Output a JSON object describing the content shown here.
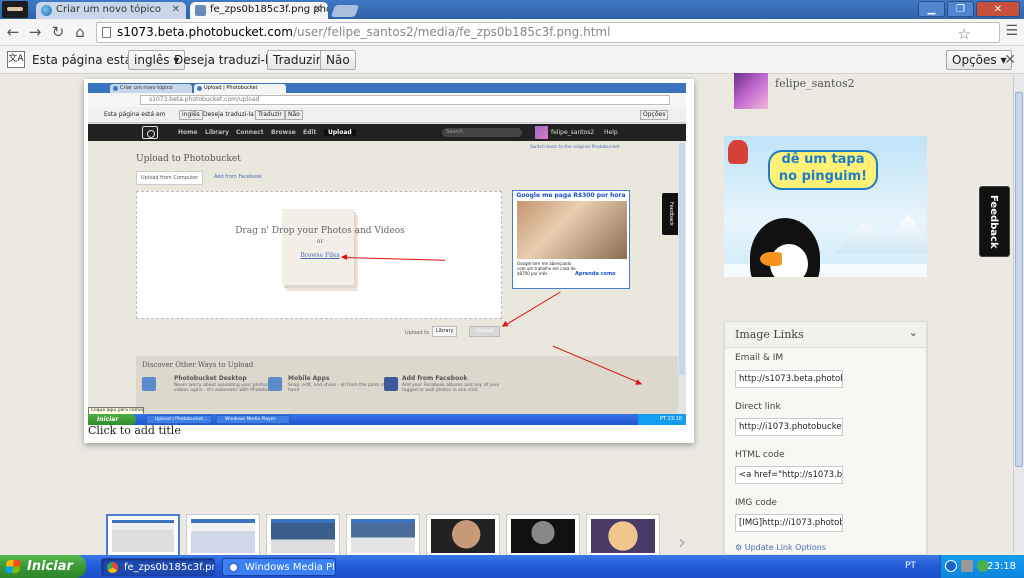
{
  "browser": {
    "tabs": [
      {
        "label": "Criar um novo tópico"
      },
      {
        "label": "fe_zps0b185c3f.png photo b"
      }
    ],
    "url_host": "s1073.beta.photobucket.com",
    "url_path": "/user/felipe_santos2/media/fe_zps0b185c3f.png.html"
  },
  "translate_bar": {
    "prefix": "Esta página está em",
    "language": "inglês",
    "question": "Deseja traduzi-la?",
    "translate": "Traduzir",
    "no": "Não",
    "options": "Opções"
  },
  "viewer": {
    "caption": "Click to add title",
    "inner": {
      "tabs": [
        "Criar um novo tópico",
        "Upload | Photobucket"
      ],
      "url": "s1073.beta.photobucket.com/upload",
      "translate_prefix": "Esta página está em",
      "translate_lang": "inglês",
      "translate_q": "Deseja traduzi-la?",
      "translate_btn": "Traduzir",
      "translate_no": "Não",
      "translate_opts": "Opções",
      "nav": [
        "Home",
        "Library",
        "Connect",
        "Browse",
        "Edit",
        "Upload"
      ],
      "search_placeholder": "Search",
      "username": "felipe_santos2",
      "help": "Help",
      "switch_back": "Switch back to the original Photobucket",
      "heading": "Upload to Photobucket",
      "tab_computer": "Upload from Computer",
      "tab_facebook": "Add from Facebook",
      "drop_title": "Drag n' Drop your Photos and Videos",
      "drop_or": "or",
      "drop_link": "Browse Files",
      "ad_title": "Google me paga R$300 por hora",
      "ad_text": "Google tem me abençoado com um trabalho em casa de $8700 por mês",
      "ad_link": "Aprenda como",
      "upload_to": "Upload to",
      "library": "Library",
      "upload_btn": "Upload",
      "discover_title": "Discover Other Ways to Upload",
      "features": [
        {
          "title": "Photobucket Desktop",
          "text": "Never worry about uploading your photos and videos again - it's automatic with Photobucket"
        },
        {
          "title": "Mobile Apps",
          "text": "Snap, edit, and share - all from the palm of your hand"
        },
        {
          "title": "Add from Facebook",
          "text": "Add your Facebook albums and any of your tagged or wall photos in one click"
        }
      ],
      "feedback": "Feedback",
      "tooltip": "Clique aqui para começar",
      "start": "Iniciar",
      "tasks": [
        "Upload | Photobucket...",
        "Windows Media Player"
      ],
      "tray_lang": "PT",
      "clock": "23:10"
    }
  },
  "right_panel": {
    "username": "felipe_santos2",
    "promo_line1": "dê um tapa",
    "promo_line2": "no pinguim!",
    "card_title": "Image Links",
    "fields": [
      {
        "label": "Email & IM",
        "value": "http://s1073.beta.photobuck"
      },
      {
        "label": "Direct link",
        "value": "http://i1073.photobucket.com"
      },
      {
        "label": "HTML code",
        "value": "<a href=\"http://s1073.beta.p"
      },
      {
        "label": "IMG code",
        "value": "[IMG]http://i1073.photobucke"
      }
    ],
    "update": "Update Link Options"
  },
  "feedback": "Feedback",
  "taskbar": {
    "start": "Iniciar",
    "tasks": [
      "fe_zps0b185c3f.png ...",
      "Windows Media Player"
    ],
    "lang": "PT",
    "clock": "23:18"
  },
  "colors": {
    "annotation_red": "#e01010",
    "xp_blue": "#245edb",
    "link_blue": "#4a6fb5"
  }
}
